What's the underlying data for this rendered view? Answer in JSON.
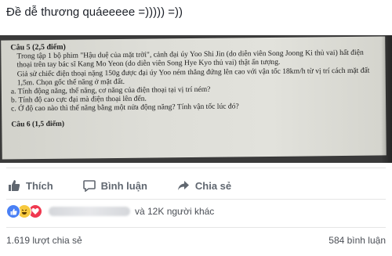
{
  "post": {
    "caption": "Đề dễ thương quáeeeee =))))) =))"
  },
  "photo": {
    "question_title": "Câu 5 (2,5 điểm)",
    "paragraph_1": "Trong tập 1 bộ phim \"Hậu duệ của mặt trời\", cảnh đại úy Yoo Shi Jin (do diễn viên Song Joong Ki thủ vai) hất điện thoại trên tay bác sĩ Kang Mo Yeon (do diễn viên Song Hye Kyo thủ vai) thật ấn tượng.",
    "paragraph_2": "Giả sử chiếc điện thoại nặng 150g được đại úy Yoo ném thẳng đứng lên cao với vận tốc 18km/h từ vị trí cách mặt đất 1,5m. Chọn gốc thế năng ở mặt đất.",
    "item_a": "a. Tính động năng, thế năng, cơ năng của điện thoại tại vị trí ném?",
    "item_b": "b. Tính độ cao cực đại mà điện thoại lên đến.",
    "item_c": "c. Ở độ cao nào thì thế năng bằng một nửa động năng? Tính vận tốc lúc đó?",
    "next_question": "Câu 6 (1,5 điểm)"
  },
  "actions": {
    "like_label": "Thích",
    "comment_label": "Bình luận",
    "share_label": "Chia sẻ",
    "like_icon": "thumbs-up-icon",
    "comment_icon": "speech-bubble-icon",
    "share_icon": "share-arrow-icon"
  },
  "reactions": {
    "icons": [
      "like-reaction-icon",
      "haha-reaction-icon",
      "love-reaction-icon"
    ],
    "others_text": "và 12K người khác",
    "colors": {
      "like": "#4a80f5",
      "haha": "#f7c93e",
      "love": "#f0384f"
    }
  },
  "stats": {
    "shares": "1.619 lượt chia sẻ",
    "comments": "584 bình luận"
  }
}
